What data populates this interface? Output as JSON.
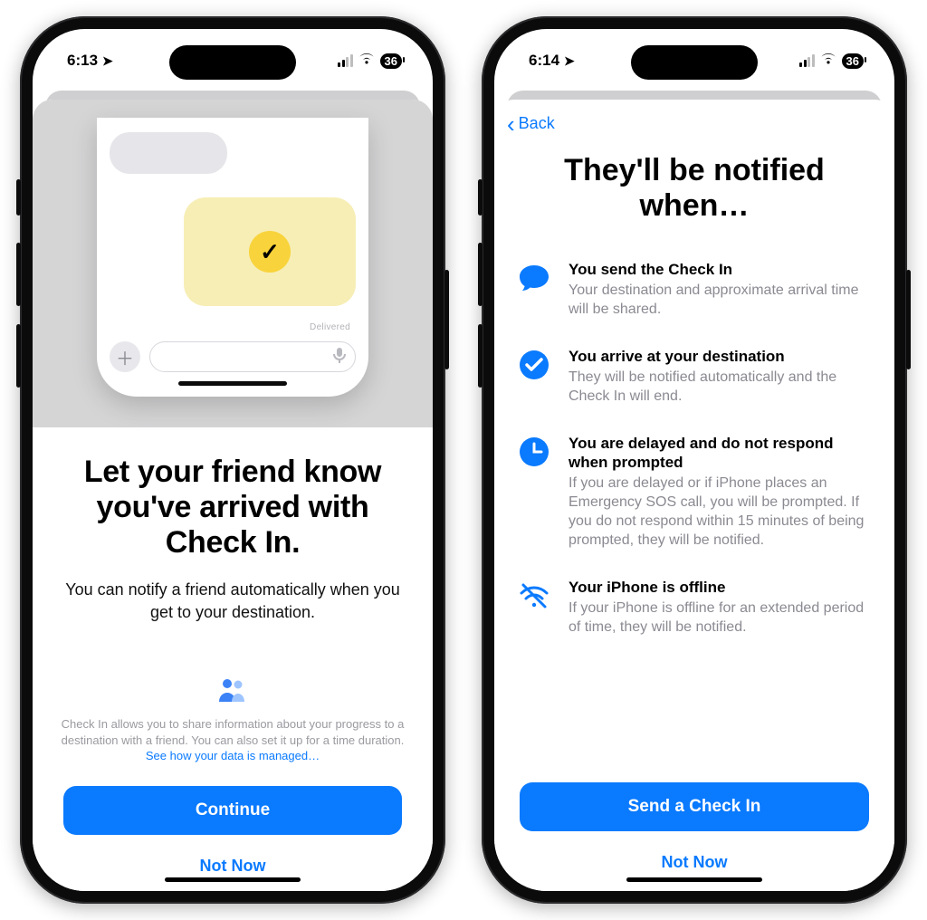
{
  "left": {
    "status": {
      "time": "6:13",
      "battery": "36"
    },
    "title": "Let your friend know you've arrived with Check In.",
    "subtitle": "You can notify a friend automatically when you get to your destination.",
    "privacy_pre": "Check In allows you to share information about your progress to a destination with a friend. You can also set it up for a time duration. ",
    "privacy_link": "See how your data is managed…",
    "continue": "Continue",
    "not_now": "Not Now",
    "mock": {
      "delivered": "Delivered"
    }
  },
  "right": {
    "status": {
      "time": "6:14",
      "battery": "36"
    },
    "back": "Back",
    "title": "They'll be notified when…",
    "items": [
      {
        "head": "You send the Check In",
        "sub": "Your destination and approximate arrival time will be shared."
      },
      {
        "head": "You arrive at your destination",
        "sub": "They will be notified automatically and the Check In will end."
      },
      {
        "head": "You are delayed and do not respond when prompted",
        "sub": "If you are delayed or if iPhone places an Emergency SOS call, you will be prompted. If you do not respond within 15 minutes of being prompted, they will be notified."
      },
      {
        "head": "Your iPhone is offline",
        "sub": "If your iPhone is offline for an extended period of time, they will be notified."
      }
    ],
    "send": "Send a Check In",
    "not_now": "Not Now"
  }
}
